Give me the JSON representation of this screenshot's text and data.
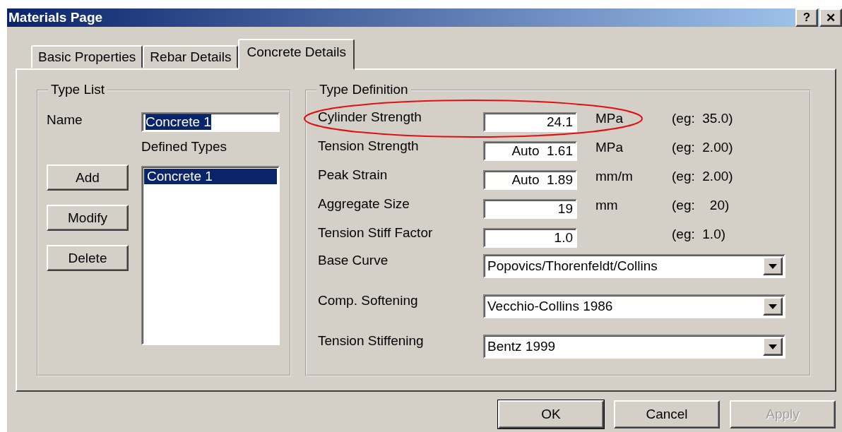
{
  "window": {
    "title": "Materials Page",
    "buttons": [
      "?",
      "✕"
    ]
  },
  "tabs": [
    {
      "label": "Basic Properties",
      "selected": false
    },
    {
      "label": "Rebar Details",
      "selected": false
    },
    {
      "label": "Concrete Details",
      "selected": true
    }
  ],
  "type_list": {
    "title": "Type List",
    "name_label": "Name",
    "name_value": "Concrete 1",
    "name_selected": true,
    "defined_label": "Defined Types",
    "buttons": [
      "Add",
      "Modify",
      "Delete"
    ],
    "items": [
      {
        "label": "Concrete 1",
        "selected": true
      }
    ]
  },
  "type_definition": {
    "title": "Type Definition",
    "rows": [
      {
        "kind": "text",
        "label": "Cylinder Strength",
        "value": "24.1",
        "unit": "MPa",
        "example": "(eg:  35.0)",
        "highlighted": true
      },
      {
        "kind": "text",
        "label": "Tension Strength",
        "value": "Auto  1.61",
        "unit": "MPa",
        "example": "(eg:  2.00)",
        "highlighted": false
      },
      {
        "kind": "text",
        "label": "Peak Strain",
        "value": "Auto  1.89",
        "unit": "mm/m",
        "example": "(eg:  2.00)",
        "highlighted": false
      },
      {
        "kind": "text",
        "label": "Aggregate Size",
        "value": "19",
        "unit": "mm",
        "example": "(eg:    20)",
        "highlighted": false
      },
      {
        "kind": "text",
        "label": "Tension Stiff Factor",
        "value": "1.0",
        "example": "(eg:  1.0)",
        "highlighted": false
      },
      {
        "kind": "select",
        "label": "Base Curve",
        "value": "Popovics/Thorenfeldt/Collins"
      },
      {
        "kind": "select",
        "label": "Comp. Softening",
        "value": "Vecchio-Collins 1986"
      },
      {
        "kind": "select",
        "label": "Tension Stiffening",
        "value": "Bentz 1999"
      }
    ]
  },
  "footer": [
    {
      "label": "OK",
      "disabled": false,
      "default": true
    },
    {
      "label": "Cancel",
      "disabled": false,
      "default": false
    },
    {
      "label": "Apply",
      "disabled": true,
      "default": false
    }
  ]
}
